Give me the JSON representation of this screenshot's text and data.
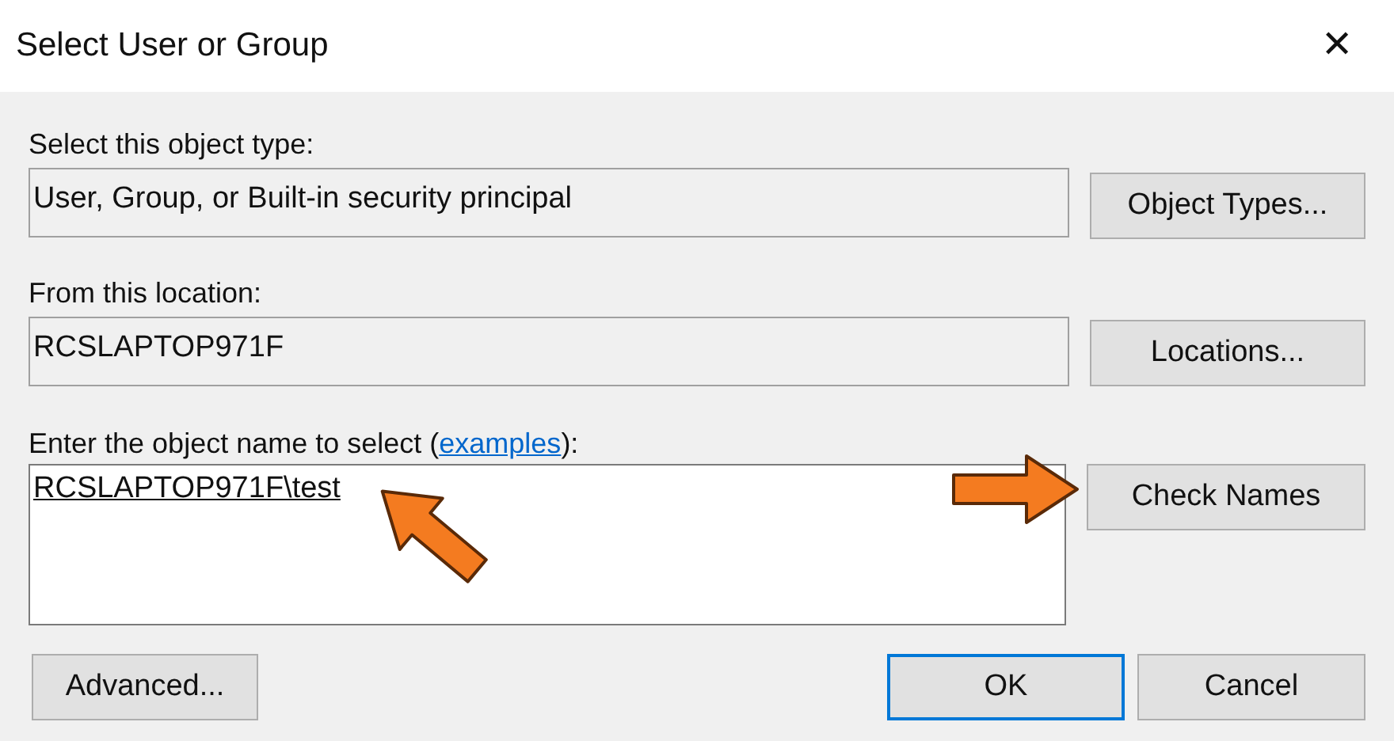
{
  "window": {
    "title": "Select User or Group",
    "close": "✕"
  },
  "object_type": {
    "label": "Select this object type:",
    "value": "User, Group, or Built-in security principal",
    "button": "Object Types..."
  },
  "location": {
    "label": "From this location:",
    "value": "RCSLAPTOP971F",
    "button": "Locations..."
  },
  "object_name": {
    "label_before": "Enter the object name to select (",
    "link": "examples",
    "label_after": "):",
    "value": "RCSLAPTOP971F\\test",
    "underlined": true,
    "button": "Check Names"
  },
  "buttons": [
    {
      "label": "Advanced...",
      "default": false
    },
    {
      "label": "OK",
      "default": true
    },
    {
      "label": "Cancel",
      "default": false
    }
  ]
}
